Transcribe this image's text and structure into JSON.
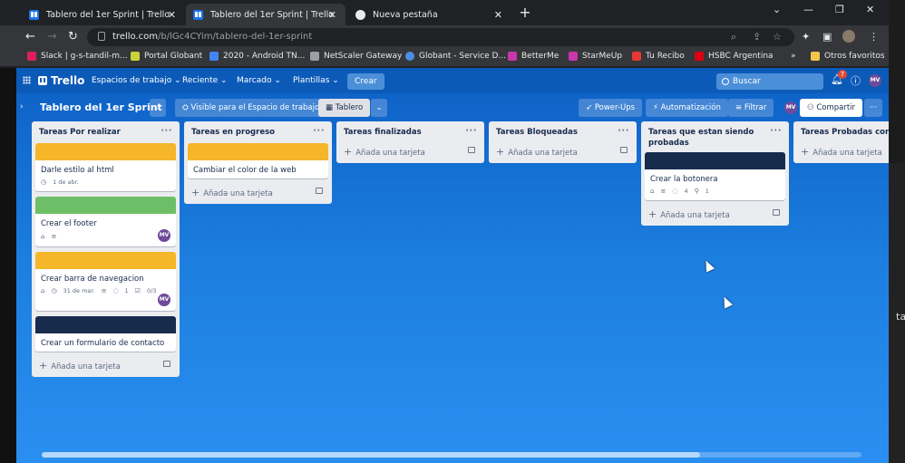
{
  "browser": {
    "tabs": [
      {
        "title": "Tablero del 1er Sprint | Trello",
        "active": false
      },
      {
        "title": "Tablero del 1er Sprint | Trello",
        "active": true
      },
      {
        "title": "Nueva pestaña",
        "active": false
      }
    ],
    "url_host": "trello.com",
    "url_path": "/b/lGc4CYim/tablero-del-1er-sprint",
    "bookmarks": [
      {
        "label": "Slack | g-s-tandil-m...",
        "color": "#e01e5a"
      },
      {
        "label": "Portal Globant",
        "color": "#c9d33b"
      },
      {
        "label": "2020 - Android TN...",
        "color": "#4285f4"
      },
      {
        "label": "NetScaler Gateway",
        "color": "#9aa0a6"
      },
      {
        "label": "Globant - Service D...",
        "color": "#4a90e2"
      },
      {
        "label": "BetterMe",
        "color": "#c837ab"
      },
      {
        "label": "StarMeUp",
        "color": "#c837ab"
      },
      {
        "label": "Tu Recibo",
        "color": "#e53935"
      },
      {
        "label": "HSBC Argentina",
        "color": "#db0011"
      }
    ],
    "bookmarks_more": "»",
    "other_bookmarks": "Otros favoritos"
  },
  "trello": {
    "logo": "Trello",
    "menus": [
      "Espacios de trabajo",
      "Reciente",
      "Marcado",
      "Plantillas"
    ],
    "create": "Crear",
    "search_placeholder": "Buscar",
    "notif_count": "7",
    "user_initials": "MV"
  },
  "board": {
    "title": "Tablero del 1er Sprint",
    "visibility": "Visible para el Espacio de trabajo",
    "view": "Tablero",
    "powerups": "Power-Ups",
    "automation": "Automatización",
    "filter": "Filtrar",
    "share": "Compartir"
  },
  "lists": [
    {
      "title": "Tareas Por realizar",
      "add": "Añada una tarjeta",
      "cards": [
        {
          "title": "Darle estilo al html",
          "cover": "#f5b62a",
          "due": "1 de abr."
        },
        {
          "title": "Crear el footer",
          "cover": "#6dbf67",
          "member": "MV"
        },
        {
          "title": "Crear barra de navegacion",
          "cover": "#f5b62a",
          "due": "31 de mar.",
          "comments": "1",
          "checklist": "0/3",
          "member": "MV"
        },
        {
          "title": "Crear un formulario de contacto",
          "cover": "#172b4d"
        }
      ]
    },
    {
      "title": "Tareas en progreso",
      "add": "Añada una tarjeta",
      "cards": [
        {
          "title": "Cambiar el color de la web",
          "cover": "#f5b62a"
        }
      ]
    },
    {
      "title": "Tareas finalizadas",
      "add": "Añada una tarjeta",
      "cards": []
    },
    {
      "title": "Tareas Bloqueadas",
      "add": "Añada una tarjeta",
      "cards": []
    },
    {
      "title": "Tareas que estan siendo probadas",
      "add": "Añada una tarjeta",
      "cards": [
        {
          "title": "Crear la botonera",
          "cover": "#172b4d",
          "comments": "4",
          "attachments": "1"
        }
      ]
    },
    {
      "title": "Tareas Probadas correcta",
      "add": "Añada una tarjeta",
      "cards": []
    }
  ],
  "overflow_text": "ta",
  "colors": {
    "trello_blue": "#0c5ab8",
    "list_bg": "#ebecf0"
  },
  "icons": {
    "list_menu": "···",
    "card_template": "card-template-icon",
    "label_tag": "tag-icon",
    "description": "description-icon"
  }
}
